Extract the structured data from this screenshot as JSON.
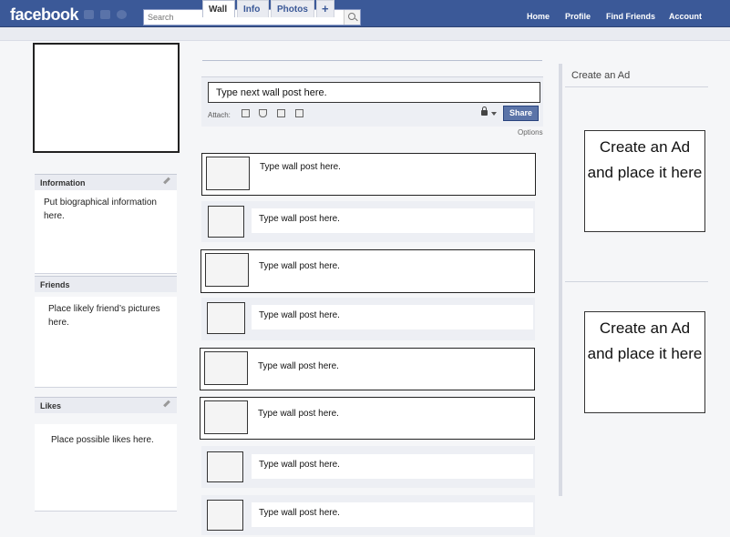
{
  "topbar": {
    "logo": "facebook",
    "search_placeholder": "Search",
    "nav": [
      "Home",
      "Profile",
      "Find Friends",
      "Account"
    ]
  },
  "tabs": [
    "Wall",
    "Info",
    "Photos",
    "+"
  ],
  "composer": {
    "input_value": "Type next wall post here.",
    "attach_label": "Attach:",
    "share_label": "Share",
    "options_label": "Options"
  },
  "sidebar": {
    "information": {
      "title": "Information",
      "body": "Put biographical information here."
    },
    "friends": {
      "title": "Friends",
      "body": "Place likely friend’s pictures here."
    },
    "likes": {
      "title": "Likes",
      "body": "Place possible likes here."
    }
  },
  "posts": [
    "Type wall post here.",
    "Type wall post here.",
    "Type wall post here.",
    "Type wall post here.",
    "Type wall post here.",
    "Type wall post here.",
    "Type wall post here.",
    "Type wall post here."
  ],
  "ads": {
    "heading": "Create an Ad",
    "ad1": "Create an Ad and place it here",
    "ad2": "Create an Ad and place it here"
  },
  "colors": {
    "brand": "#3b5998",
    "share": "#5b74a8"
  },
  "icons": [
    "search-icon",
    "photo-icon",
    "event-icon",
    "video-icon",
    "link-icon",
    "lock-icon",
    "pencil-icon"
  ]
}
